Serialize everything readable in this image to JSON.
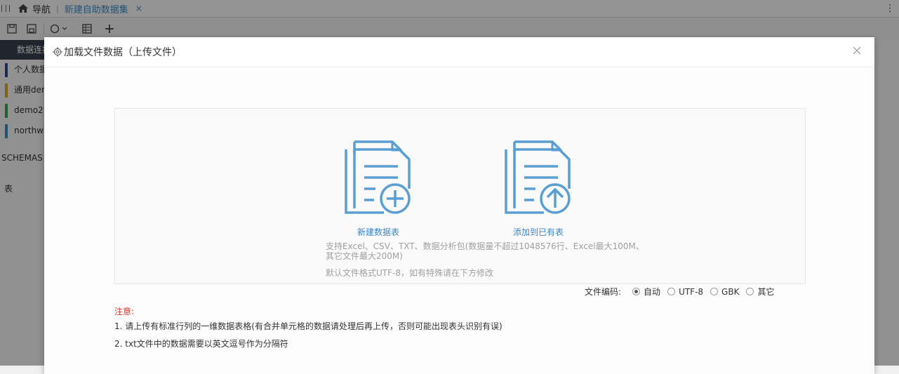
{
  "topbar": {
    "nav_label": "导航",
    "tab_label": "新建自助数据集",
    "tab_close": "×",
    "more": "⋮"
  },
  "left_panel": {
    "header": "数据连接",
    "items": [
      {
        "label": "个人数据",
        "color": "#2c4a8a"
      },
      {
        "label": "通用demo",
        "color": "#e1a529"
      },
      {
        "label": "demo2",
        "color": "#3aa35a"
      },
      {
        "label": "northwind",
        "color": "#3d8fc9"
      }
    ],
    "schemas_label": "SCHEMAS",
    "table_label": "表"
  },
  "modal": {
    "title": "加载文件数据（上传文件）",
    "options": [
      {
        "label": "新建数据表",
        "icon": "doc-plus-icon"
      },
      {
        "label": "添加到已有表",
        "icon": "doc-upload-icon"
      }
    ],
    "support_line1": "支持Excel、CSV、TXT、数据分析包(数据量不超过1048576行、Excel最大100M、",
    "support_line2": "其它文件最大200M)",
    "encoding_hint": "默认文件格式UTF-8，如有特殊请在下方修改",
    "encoding": {
      "label": "文件编码:",
      "options": [
        "自动",
        "UTF-8",
        "GBK",
        "其它"
      ],
      "selected": "自动"
    },
    "notes": {
      "title": "注意:",
      "line1": "1. 请上传有标准行列的一维数据表格(有合并单元格的数据请处理后再上传，否则可能出现表头识别有误)",
      "line2": "2. txt文件中的数据需要以英文逗号作为分隔符"
    }
  },
  "colors": {
    "accent": "#3b86c6",
    "icon_stroke": "#5a9fd4",
    "warning": "#d9352b"
  }
}
